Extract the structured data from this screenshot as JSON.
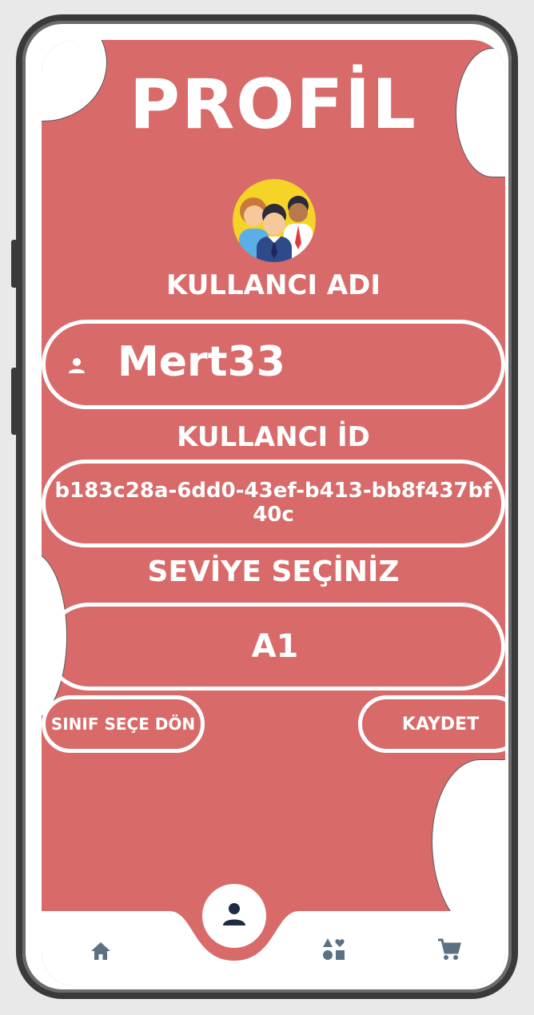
{
  "page": {
    "title": "PROFİL"
  },
  "profile": {
    "username_label": "KULLANCI ADI",
    "username": "Mert33",
    "id_label": "KULLANCI İD",
    "user_id": "b183c28a-6dd0-43ef-b413-bb8f437bf40c",
    "level_label": "SEVİYE SEÇİNİZ",
    "level": "A1"
  },
  "actions": {
    "back_label": "SINIF SEÇE DÖN",
    "save_label": "KAYDET"
  },
  "colors": {
    "background": "#d86a6a",
    "text": "#ffffff",
    "nav_icon": "#5b7083",
    "nav_active_icon": "#1f2a44"
  },
  "icons": {
    "avatar": "people-group-avatar",
    "username": "person-icon",
    "nav_home": "home-icon",
    "nav_profile": "person-icon",
    "nav_shapes": "shapes-icon",
    "nav_cart": "cart-icon"
  }
}
